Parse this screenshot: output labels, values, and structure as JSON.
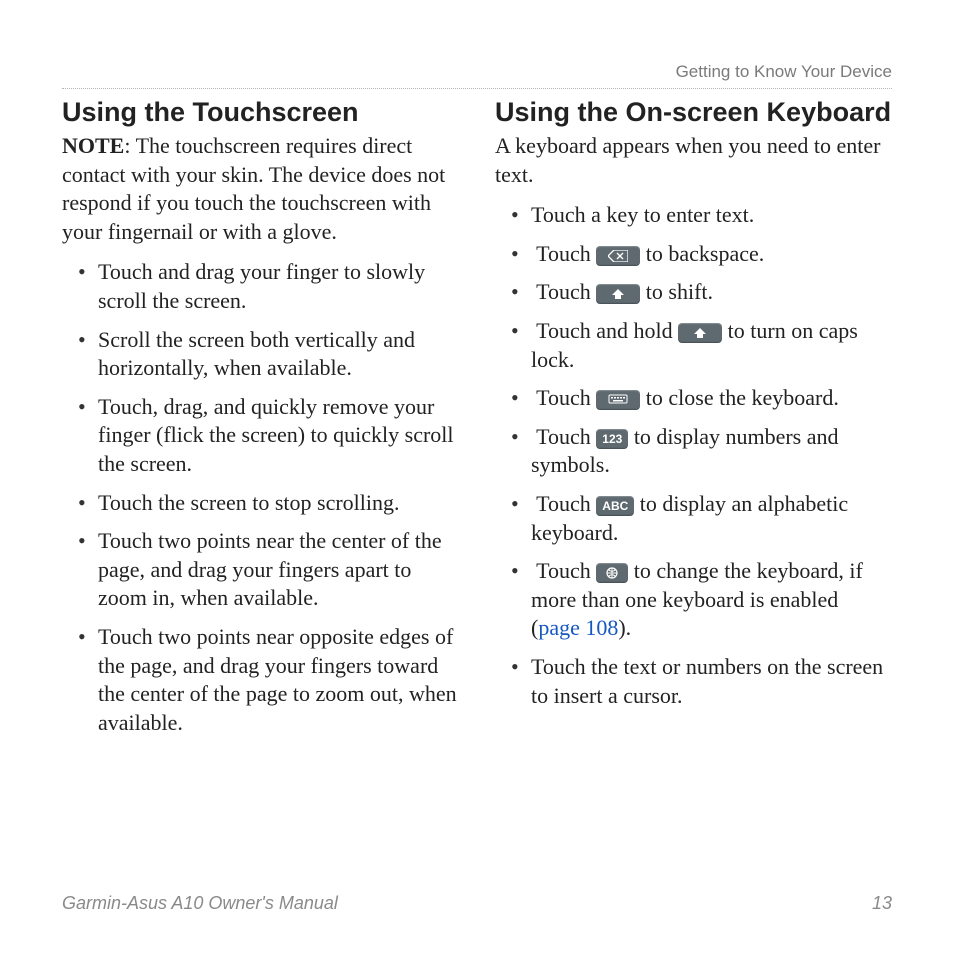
{
  "header": {
    "section": "Getting to Know Your Device"
  },
  "left": {
    "heading": "Using the Touchscreen",
    "note_label": "NOTE",
    "note_body": ": The touchscreen requires direct contact with your skin. The device does not respond if you touch the touchscreen with your fingernail or with a glove.",
    "items": [
      "Touch and drag your finger to slowly scroll the screen.",
      "Scroll the screen both vertically and horizontally, when available.",
      "Touch, drag, and quickly remove your finger (flick the screen) to quickly scroll the screen.",
      "Touch the screen to stop scrolling.",
      "Touch two points near the center of the page, and drag your fingers apart to zoom in, when available.",
      "Touch two points near opposite edges of the page, and drag your fingers toward the center of the page to zoom out, when available."
    ]
  },
  "right": {
    "heading": "Using the On-screen Keyboard",
    "intro": "A keyboard appears when you need to enter text.",
    "items": {
      "r0": "Touch a key to enter text.",
      "r1_a": "Touch ",
      "r1_b": " to backspace.",
      "r2_a": "Touch ",
      "r2_b": " to shift.",
      "r3_a": "Touch and hold ",
      "r3_b": " to turn on caps lock.",
      "r4_a": "Touch ",
      "r4_b": " to close the keyboard.",
      "r5_a": "Touch ",
      "r5_b": " to display numbers and symbols.",
      "r6_a": "Touch ",
      "r6_b": " to display an alphabetic keyboard.",
      "r7_a": "Touch ",
      "r7_b": " to change the keyboard, if more than one keyboard is enabled (",
      "r7_link": "page 108",
      "r7_c": ").",
      "r8": "Touch the text or numbers on the screen to insert a cursor."
    },
    "icon_labels": {
      "num": "123",
      "abc": "ABC"
    }
  },
  "footer": {
    "title": "Garmin-Asus A10 Owner's Manual",
    "page": "13"
  }
}
